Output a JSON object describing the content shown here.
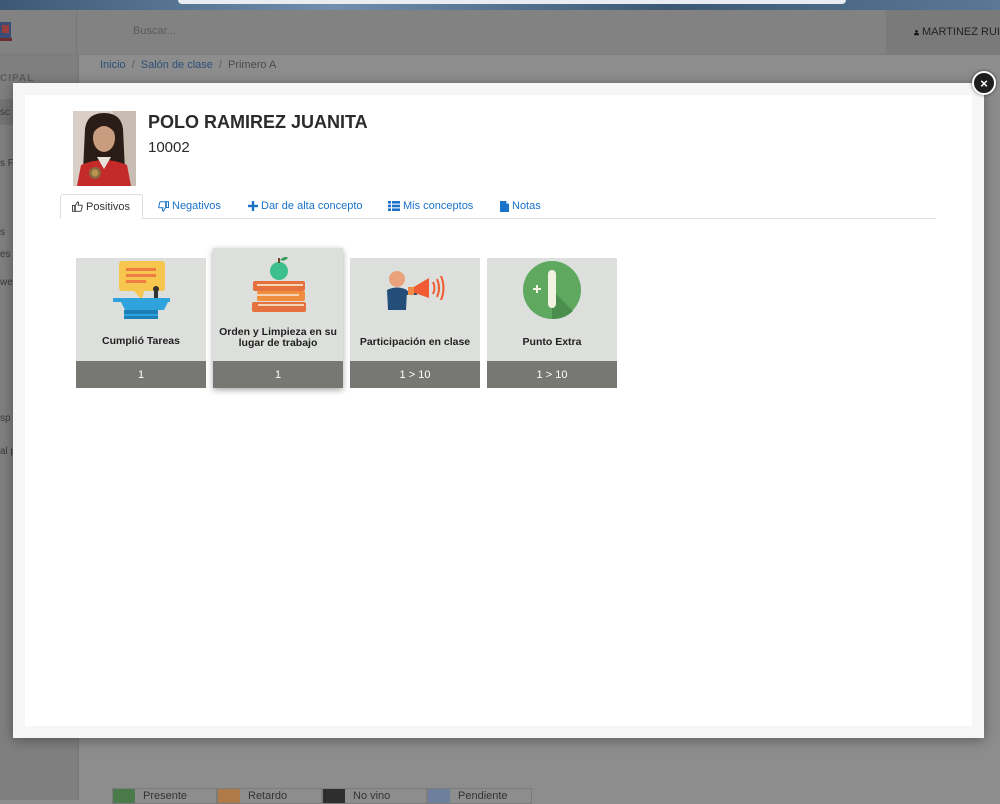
{
  "navbar": {
    "search_placeholder": "Buscar...",
    "user_name": "MARTINEZ RUI"
  },
  "sidebar": {
    "fragments": [
      "CIPAL",
      "sc",
      "s F",
      "s",
      "es",
      "we",
      "sp",
      "al p"
    ]
  },
  "breadcrumb": {
    "items": [
      "Inicio",
      "Salón de clase",
      "Primero A"
    ]
  },
  "legend": {
    "items": [
      {
        "label": "Presente",
        "color": "#4a7a4a"
      },
      {
        "label": "Retardo",
        "color": "#b07a48"
      },
      {
        "label": "No vino",
        "color": "#2e2e2e"
      },
      {
        "label": "Pendiente",
        "color": "#6d7f9c"
      }
    ]
  },
  "modal": {
    "close_symbol": "×",
    "student": {
      "name": "POLO RAMIREZ JUANITA",
      "id": "10002"
    },
    "tabs": [
      {
        "label": "Positivos",
        "icon": "thumbs-up-icon"
      },
      {
        "label": "Negativos",
        "icon": "thumbs-down-icon"
      },
      {
        "label": "Dar de alta concepto",
        "icon": "plus-icon"
      },
      {
        "label": "Mis conceptos",
        "icon": "list-icon"
      },
      {
        "label": "Notas",
        "icon": "file-icon"
      }
    ],
    "active_tab": "Positivos",
    "cards": [
      {
        "label": "Cumplió Tareas",
        "value": "1",
        "icon": "podium-speech-icon"
      },
      {
        "label": "Orden y Limpieza en su lugar de trabajo",
        "value": "1",
        "icon": "books-apple-icon"
      },
      {
        "label": "Participación en clase",
        "value": "1 > 10",
        "icon": "megaphone-person-icon"
      },
      {
        "label": "Punto Extra",
        "value": "1 > 10",
        "icon": "plus-one-icon"
      }
    ]
  },
  "colors": {
    "link": "#1a72c9",
    "card_bg": "#dcdfdb",
    "card_footer": "#777873"
  }
}
